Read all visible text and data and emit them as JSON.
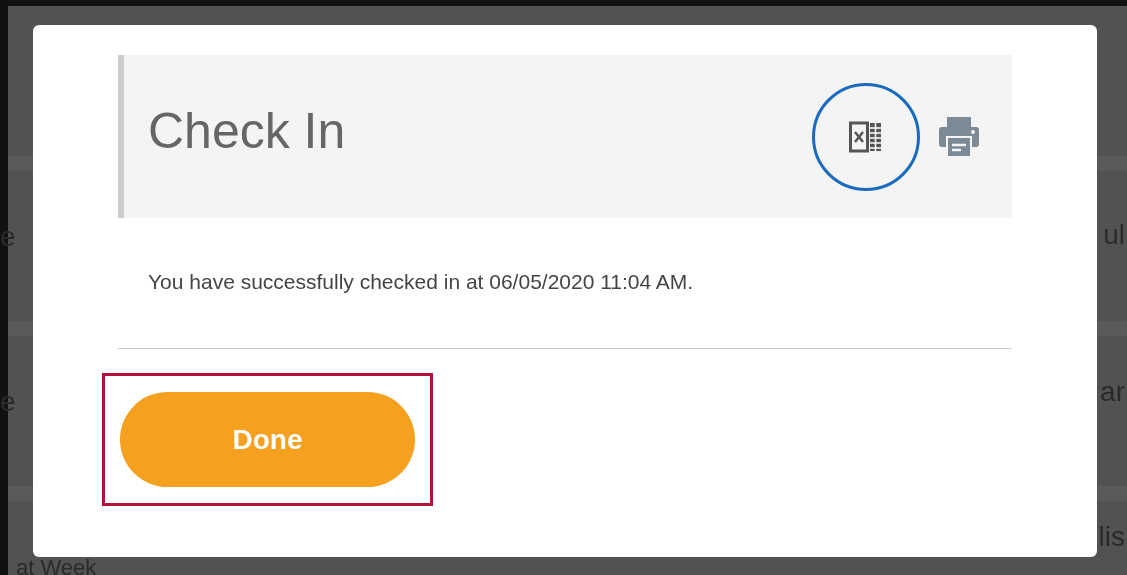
{
  "background": {
    "left_fragments": [
      "e",
      "e"
    ],
    "right_fragments": [
      "ul",
      "ar",
      "lis"
    ],
    "bottom_fragment": "at Week"
  },
  "dialog": {
    "title": "Check In",
    "message": "You have successfully checked in at 06/05/2020 11:04 AM.",
    "excel_highlighted": true,
    "done_button": {
      "label": "Done",
      "highlighted": true
    }
  }
}
